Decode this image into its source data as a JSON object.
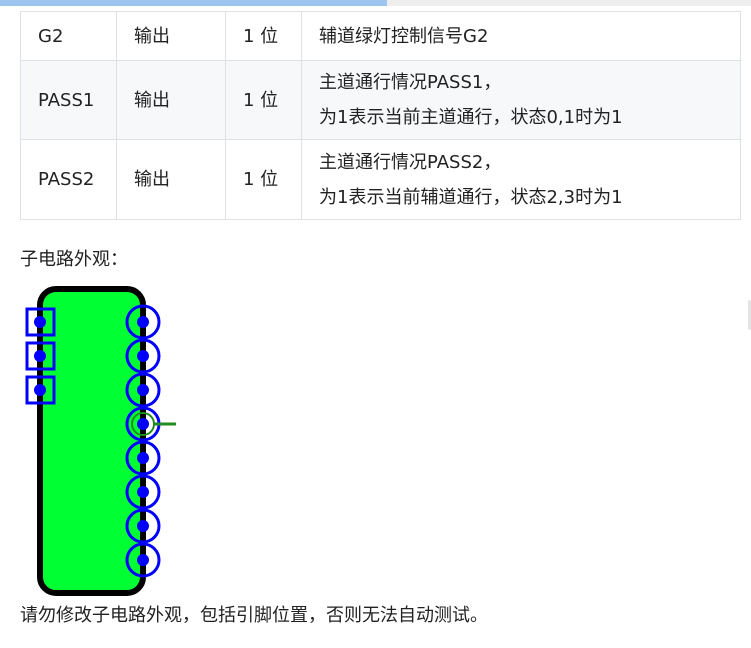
{
  "pin_table": {
    "rows": [
      {
        "name": "G2",
        "direction": "输出",
        "width": "1 位",
        "description": [
          "辅道绿灯控制信号G2"
        ]
      },
      {
        "name": "PASS1",
        "direction": "输出",
        "width": "1 位",
        "description": [
          "主道通行情况PASS1，",
          "为1表示当前主道通行，状态0,1时为1"
        ]
      },
      {
        "name": "PASS2",
        "direction": "输出",
        "width": "1 位",
        "description": [
          "主道通行情况PASS2，",
          "为1表示当前辅道通行，状态2,3时为1"
        ]
      }
    ]
  },
  "caption": "子电路外观：",
  "circuit_image": {
    "body_color": "#00ff33",
    "outline_color": "#000000",
    "pin_color": "#0000ff",
    "highlight_color": "#228b22",
    "input_pin_count": 3,
    "output_pin_count": 8
  },
  "note": "请勿修改子电路外观，包括引脚位置，否则无法自动测试。",
  "page": {
    "scroll_progress": 0.515,
    "progress_color": "#9ec5ef"
  }
}
